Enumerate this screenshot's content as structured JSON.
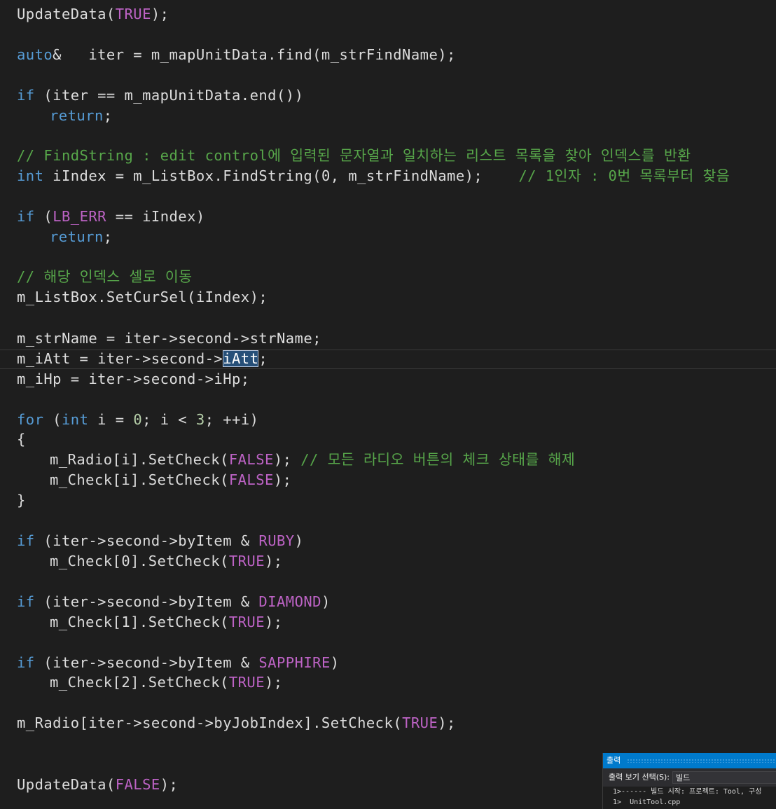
{
  "code": {
    "l1": [
      "UpdateData(",
      "TRUE",
      ");"
    ],
    "l2": [
      "auto",
      "&   iter = m_mapUnitData.find(m_strFindName);"
    ],
    "l3": [
      "if",
      " (iter == m_mapUnitData.end())"
    ],
    "l4": [
      "return",
      ";"
    ],
    "l5": "// FindString : edit control에 입력된 문자열과 일치하는 리스트 목록을 찾아 인덱스를 반환",
    "l6": [
      "int",
      " iIndex = m_ListBox.FindString(0, m_strFindName);    ",
      "// 1인자 : 0번 목록부터 찾음"
    ],
    "l7": [
      "if",
      " (",
      "LB_ERR",
      " == iIndex)"
    ],
    "l8": [
      "return",
      ";"
    ],
    "l9": "// 해당 인덱스 셀로 이동",
    "l10": "m_ListBox.SetCurSel(iIndex);",
    "l11": "m_strName = iter->second->strName;",
    "l12": [
      "m_iAtt = iter->second->",
      "iAtt",
      ";"
    ],
    "l13": "m_iHp = iter->second->iHp;",
    "l14": [
      "for",
      " (",
      "int",
      " i = ",
      "0",
      "; i < ",
      "3",
      "; ++i)"
    ],
    "l15": "{",
    "l16": [
      "m_Radio[i].SetCheck(",
      "FALSE",
      "); ",
      "// 모든 라디오 버튼의 체크 상태를 해제"
    ],
    "l17": [
      "m_Check[i].SetCheck(",
      "FALSE",
      ");"
    ],
    "l18": "}",
    "l19": [
      "if",
      " (iter->second->byItem & ",
      "RUBY",
      ")"
    ],
    "l20": [
      "m_Check[0].SetCheck(",
      "TRUE",
      ");"
    ],
    "l21": [
      "if",
      " (iter->second->byItem & ",
      "DIAMOND",
      ")"
    ],
    "l22": [
      "m_Check[1].SetCheck(",
      "TRUE",
      ");"
    ],
    "l23": [
      "if",
      " (iter->second->byItem & ",
      "SAPPHIRE",
      ")"
    ],
    "l24": [
      "m_Check[2].SetCheck(",
      "TRUE",
      ");"
    ],
    "l25": [
      "m_Radio[iter->second->byJobIndex].SetCheck(",
      "TRUE",
      ");"
    ],
    "l26": [
      "UpdateData(",
      "FALSE",
      ");"
    ]
  },
  "output": {
    "title": "출력",
    "show_from_label": "출력 보기 선택(S):",
    "show_from_value": "빌드",
    "lines": [
      "1>------ 빌드 시작: 프로젝트: Tool, 구성",
      "1>  UnitTool.cpp"
    ]
  },
  "colors": {
    "background": "#1e1e1e",
    "keyword": "#569cd6",
    "macro": "#bd63c5",
    "comment": "#57a64a",
    "text": "#dcdcdc",
    "output_title": "#007acc"
  }
}
